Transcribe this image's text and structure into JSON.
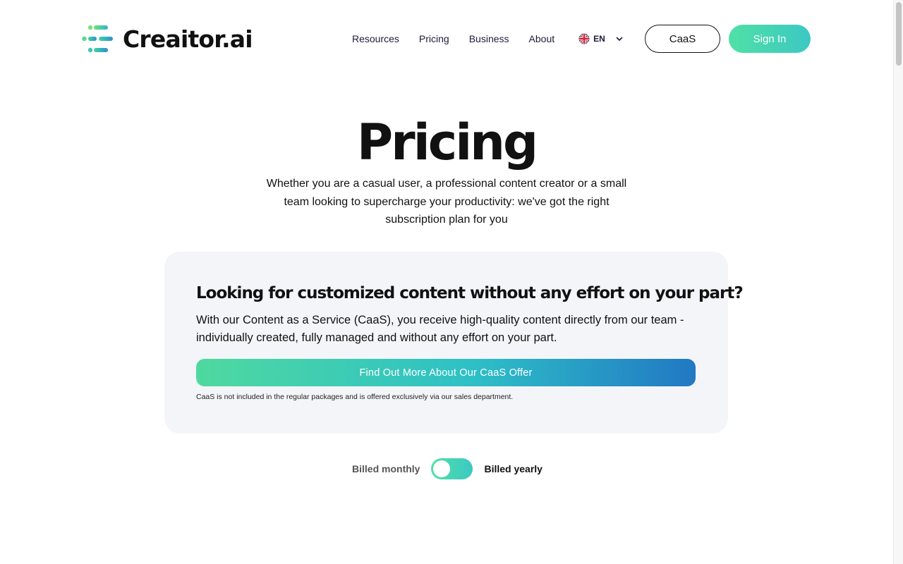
{
  "header": {
    "brand": "Creaitor.ai",
    "nav": [
      "Resources",
      "Pricing",
      "Business",
      "About"
    ],
    "language": "EN",
    "caas_button": "CaaS",
    "signin_button": "Sign In"
  },
  "hero": {
    "title": "Pricing",
    "subtitle": "Whether you are a casual user, a professional content creator or a small team looking to supercharge your productivity: we've got the right subscription plan for you"
  },
  "caas_card": {
    "title": "Looking for customized content without any effort on your part?",
    "text": "With our Content as a Service (CaaS), you receive high-quality content directly from our team - individually created, fully managed and without any effort on your part.",
    "button": "Find Out More About Our CaaS Offer",
    "note": "CaaS is not included in the regular packages and is offered exclusively via our sales department."
  },
  "billing": {
    "monthly_label": "Billed monthly",
    "yearly_label": "Billed yearly",
    "selected": "yearly"
  },
  "icons": {
    "logo": "creaitor-logo-icon",
    "flag": "uk-flag-icon",
    "chevron": "chevron-down-icon"
  },
  "colors": {
    "accent_green": "#4fe0a6",
    "accent_teal": "#3cc8c4",
    "accent_blue": "#2178c4",
    "card_bg": "#f4f5f8",
    "text": "#111111"
  }
}
